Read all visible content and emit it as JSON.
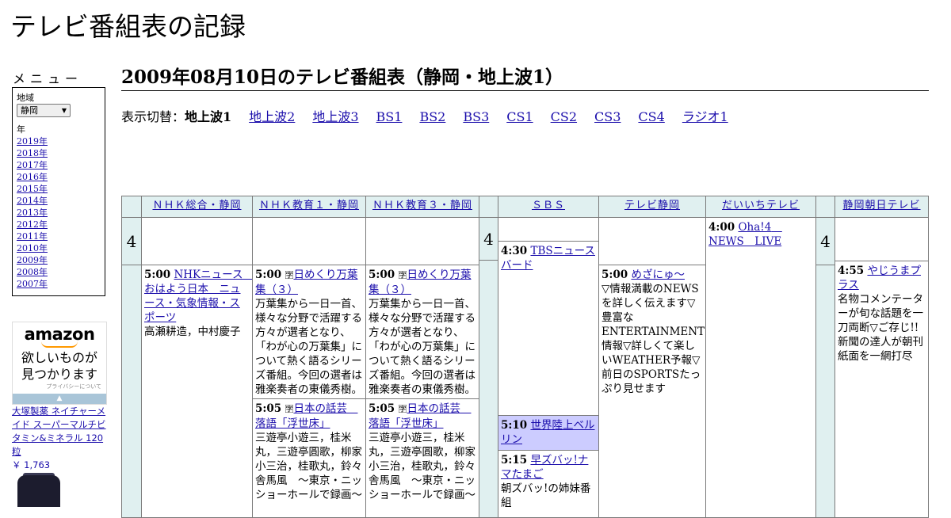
{
  "site": {
    "title": "テレビ番組表の記録"
  },
  "menu": {
    "label": "メニュー",
    "region_label": "地域",
    "region_value": "静岡",
    "year_label": "年",
    "years": [
      "2019年",
      "2018年",
      "2017年",
      "2016年",
      "2015年",
      "2014年",
      "2013年",
      "2012年",
      "2011年",
      "2010年",
      "2009年",
      "2008年",
      "2007年"
    ]
  },
  "ad": {
    "logo": "amazon",
    "tagline_1": "欲しいものが",
    "tagline_2": "見つかります",
    "privacy": "プライバシーについて",
    "product_name": "大塚製薬 ネイチャーメイド スーパーマルチビタミン&ミネラル 120粒",
    "product_price": "￥ 1,763"
  },
  "page": {
    "heading": "2009年08月10日のテレビ番組表（静岡・地上波1）"
  },
  "switch": {
    "label": "表示切替：",
    "current": "地上波1",
    "links": [
      "地上波2",
      "地上波3",
      "BS1",
      "BS2",
      "BS3",
      "CS1",
      "CS2",
      "CS3",
      "CS4",
      "ラジオ1"
    ]
  },
  "schedule": {
    "hour": "4",
    "channels": [
      "ＮＨＫ総合・静岡",
      "ＮＨＫ教育１・静岡",
      "ＮＨＫ教育３・静岡",
      "ＳＢＳ",
      "テレビ静岡",
      "だいいちテレビ",
      "静岡朝日テレビ"
    ],
    "programs": [
      {
        "id": "nhk1_500",
        "time": "5:00",
        "title": "NHKニュース　おはよう日本　ニュース・気象情報・スポーツ",
        "desc": "高瀬耕造，中村慶子"
      },
      {
        "id": "edu1_500",
        "time": "5:00",
        "icon": "epg",
        "title": "日めくり万葉集（３）",
        "desc": "万葉集から一日一首、様々な分野で活躍する方々が選者となり、「わが心の万葉集」について熱く語るシリーズ番組。今回の選者は雅楽奏者の東儀秀樹。"
      },
      {
        "id": "edu1_505",
        "time": "5:05",
        "icon": "epg",
        "title": "日本の話芸　落語「浮世床」",
        "desc": "三遊亭小遊三，桂米丸，三遊亭圓歌，柳家小三治，桂歌丸，鈴々舎馬風　～東京・ニッショーホールで録画～"
      },
      {
        "id": "edu3_500",
        "time": "5:00",
        "icon": "epg",
        "title": "日めくり万葉集（３）",
        "desc": "万葉集から一日一首、様々な分野で活躍する方々が選者となり、「わが心の万葉集」について熱く語るシリーズ番組。今回の選者は雅楽奏者の東儀秀樹。"
      },
      {
        "id": "edu3_505",
        "time": "5:05",
        "icon": "epg",
        "title": "日本の話芸　落語「浮世床」",
        "desc": "三遊亭小遊三，桂米丸，三遊亭圓歌，柳家小三治，桂歌丸，鈴々舎馬風　～東京・ニッショーホールで録画～"
      },
      {
        "id": "sbs_430",
        "time": "4:30",
        "title": "TBSニュースバード",
        "desc": ""
      },
      {
        "id": "sbs_510",
        "time": "5:10",
        "title": "世界陸上ベルリン",
        "desc": ""
      },
      {
        "id": "sbs_515",
        "time": "5:15",
        "title": "早ズバッ!ナマたまご",
        "desc": "朝ズバッ!の姉妹番組"
      },
      {
        "id": "sut_500",
        "time": "5:00",
        "title": "めざにゅ～",
        "desc": "▽情報満載のNEWSを詳しく伝えます▽豊富なENTERTAINMENT情報▽詳しくて楽しいWEATHER予報▽前日のSPORTSたっぷり見せます"
      },
      {
        "id": "dai_400",
        "time": "4:00",
        "title": "Oha!4　NEWS　LIVE",
        "desc": ""
      },
      {
        "id": "asahi_455",
        "time": "4:55",
        "title": "やじうまプラス",
        "desc": "名物コメンテーターが旬な話題を一刀両断▽ご存じ!!新聞の達人が朝刊紙面を一網打尽"
      }
    ]
  },
  "colors": {
    "header_bg": "#e0f0f0",
    "highlight_bg": "#ccccff",
    "link": "#1a0dab",
    "amazon_orange": "#ff9900"
  }
}
